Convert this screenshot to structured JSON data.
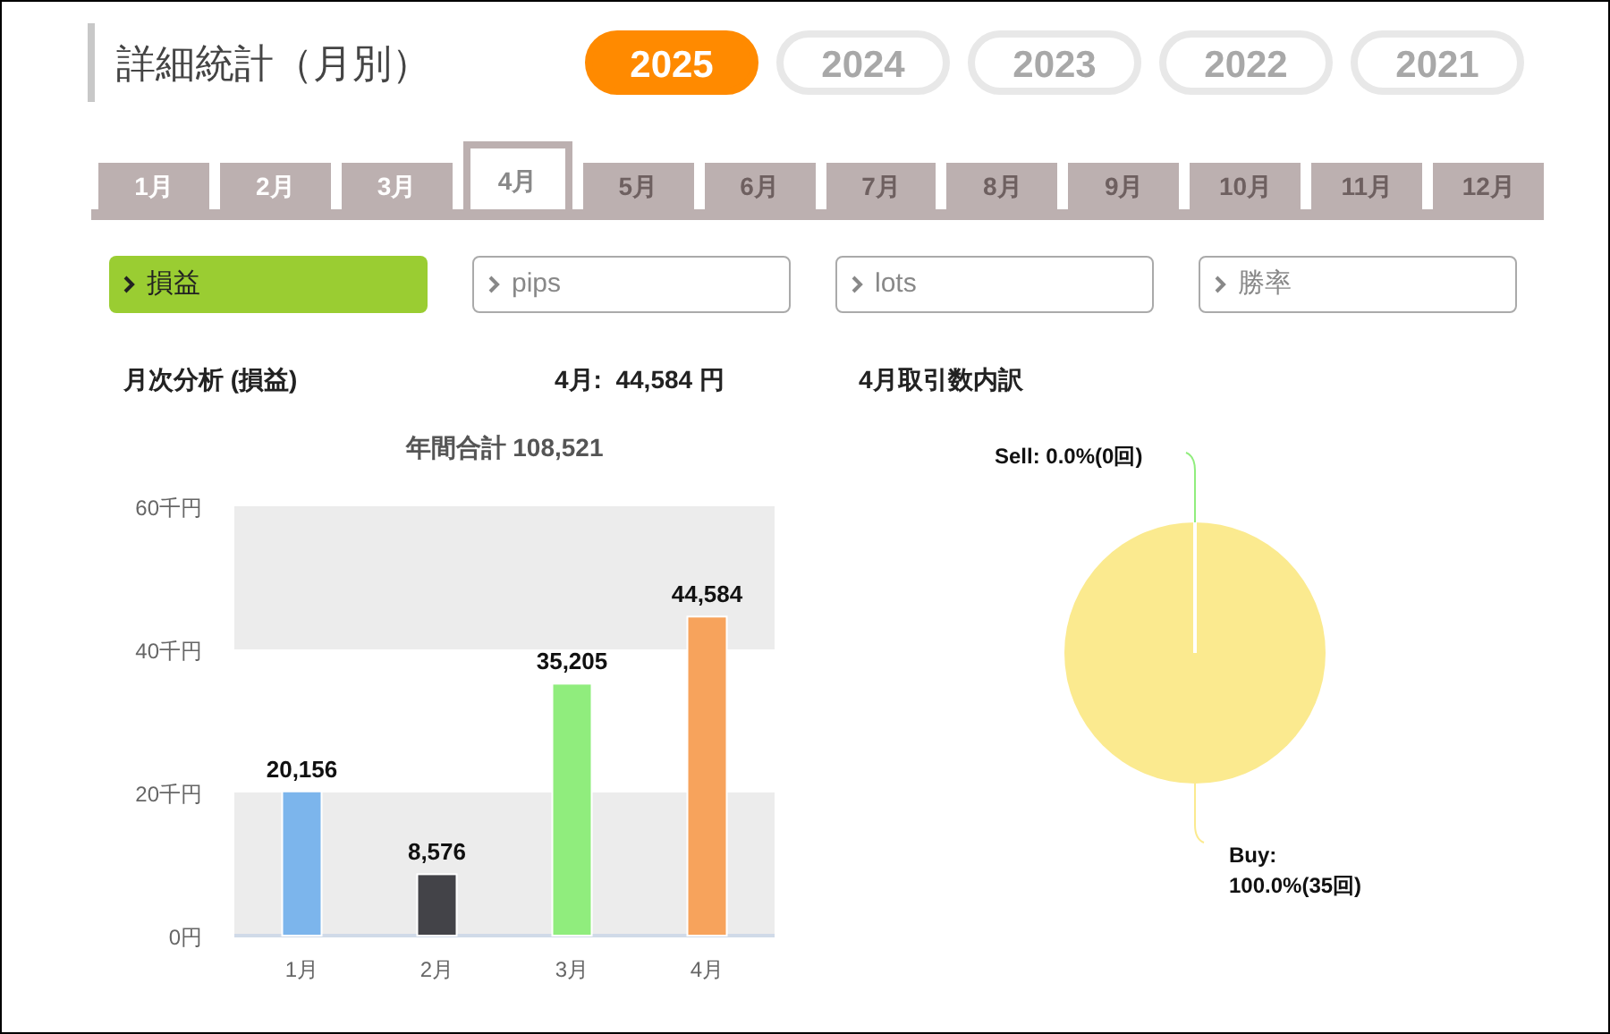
{
  "title": "詳細統計（月別）",
  "years": [
    {
      "label": "2025",
      "selected": true
    },
    {
      "label": "2024",
      "selected": false
    },
    {
      "label": "2023",
      "selected": false
    },
    {
      "label": "2022",
      "selected": false
    },
    {
      "label": "2021",
      "selected": false
    }
  ],
  "month_tabs": [
    {
      "label": "1月",
      "selected": false,
      "disabled": false
    },
    {
      "label": "2月",
      "selected": false,
      "disabled": false
    },
    {
      "label": "3月",
      "selected": false,
      "disabled": false
    },
    {
      "label": "4月",
      "selected": true,
      "disabled": false
    },
    {
      "label": "5月",
      "selected": false,
      "disabled": true
    },
    {
      "label": "6月",
      "selected": false,
      "disabled": true
    },
    {
      "label": "7月",
      "selected": false,
      "disabled": true
    },
    {
      "label": "8月",
      "selected": false,
      "disabled": true
    },
    {
      "label": "9月",
      "selected": false,
      "disabled": true
    },
    {
      "label": "10月",
      "selected": false,
      "disabled": true
    },
    {
      "label": "11月",
      "selected": false,
      "disabled": true
    },
    {
      "label": "12月",
      "selected": false,
      "disabled": true
    }
  ],
  "metrics": [
    {
      "label": "損益",
      "selected": true
    },
    {
      "label": "pips",
      "selected": false
    },
    {
      "label": "lots",
      "selected": false
    },
    {
      "label": "勝率",
      "selected": false
    }
  ],
  "headings": {
    "analysis": "月次分析 (損益)",
    "month_total": "4月:  44,584 円",
    "breakdown": "4月取引数内訳"
  },
  "bar_chart": {
    "bars": [
      {
        "color": "#7cb5ec"
      },
      {
        "color": "#434348"
      },
      {
        "color": "#90ed7d"
      },
      {
        "color": "#f7a35c"
      }
    ],
    "chart_data": {
      "type": "bar",
      "title": "年間合計 108,521",
      "categories": [
        "1月",
        "2月",
        "3月",
        "4月"
      ],
      "values": [
        20.156,
        8.576,
        35.205,
        44.584
      ],
      "ylim": [
        0,
        60
      ],
      "yticks": [
        {
          "value": 0,
          "label": "0円"
        },
        {
          "value": 20,
          "label": "20千円"
        },
        {
          "value": 40,
          "label": "40千円"
        },
        {
          "value": 60,
          "label": "60千円"
        }
      ],
      "annotations": [
        "20,156",
        "8,576",
        "35,205",
        "44,584"
      ]
    }
  },
  "pie_chart": {
    "slices": [
      {
        "color": "#90ed7d"
      },
      {
        "color": "#fbea8f"
      }
    ],
    "chart_data": {
      "type": "pie",
      "values": [
        0,
        35
      ],
      "value_labels": [
        "Sell: 0.0%(0回)",
        "Buy: 100.0%(35回)"
      ]
    }
  }
}
